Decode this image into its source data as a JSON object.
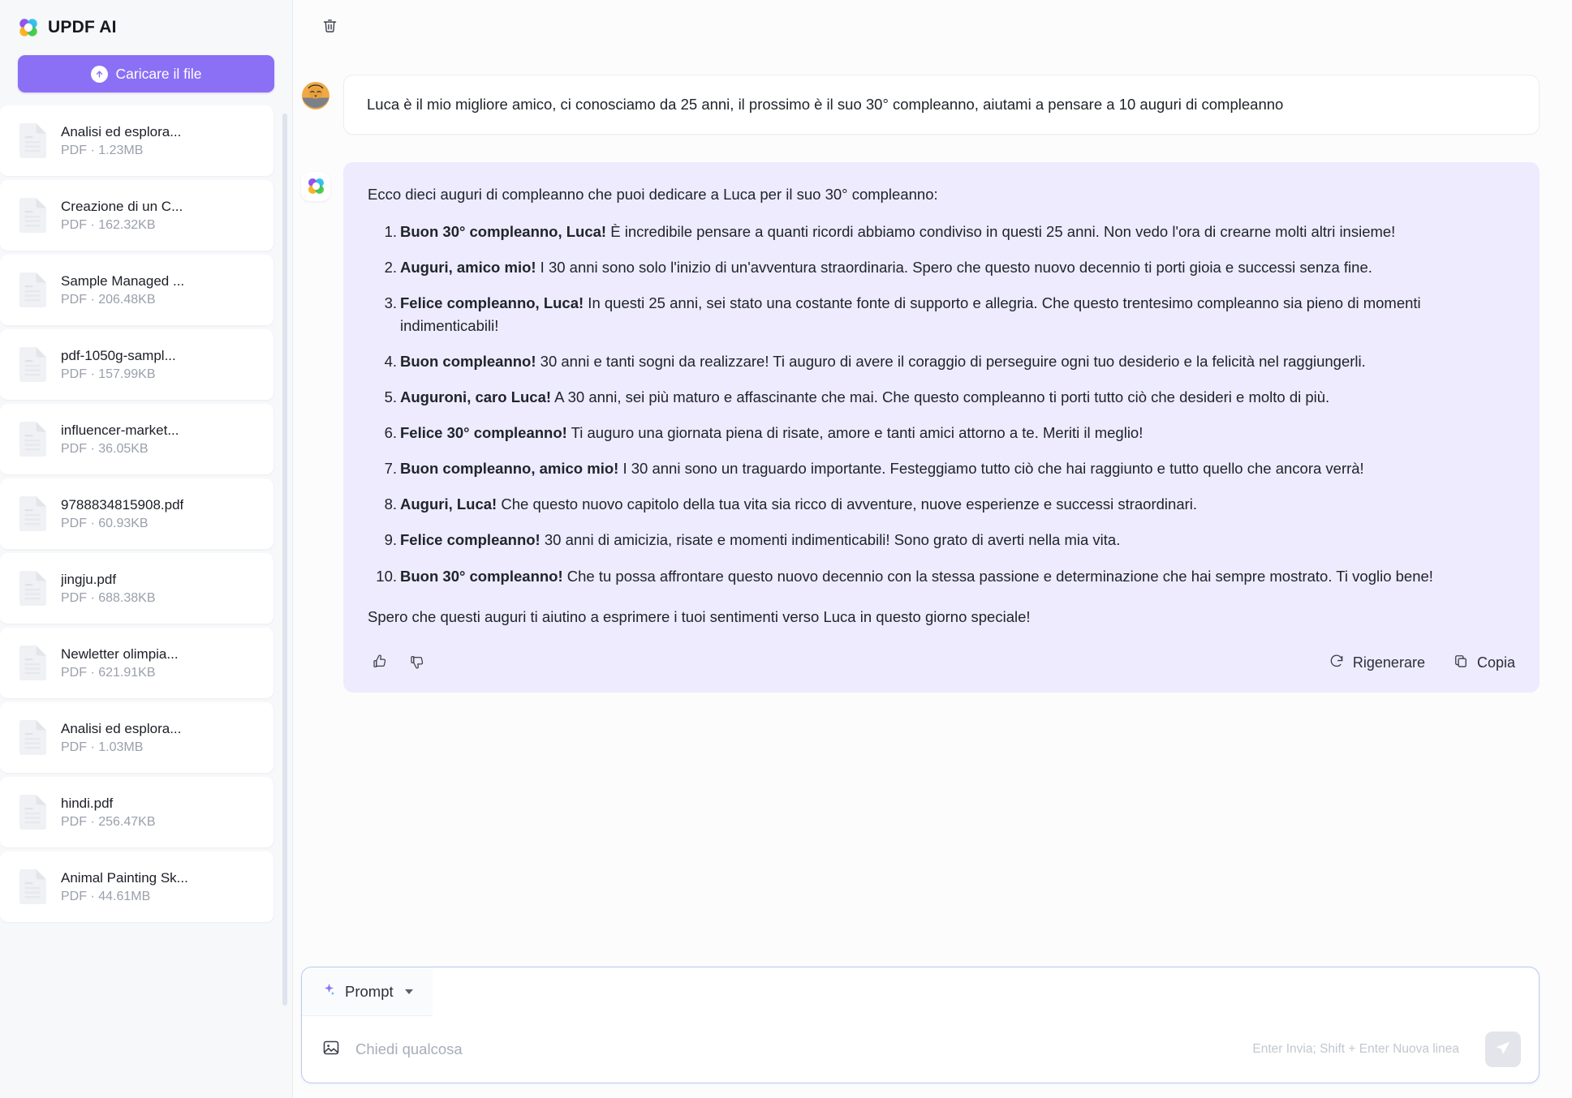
{
  "sidebar": {
    "brand": "UPDF AI",
    "brand_logo_icon": "updf-clover-logo-icon",
    "upload_button": {
      "label": "Caricare il file",
      "icon": "upload-arrow-icon",
      "color": "#8b6ff5"
    },
    "files": [
      {
        "name": "Analisi ed esplora...",
        "meta": "PDF · 1.23MB"
      },
      {
        "name": "Creazione di un C...",
        "meta": "PDF · 162.32KB"
      },
      {
        "name": "Sample Managed ...",
        "meta": "PDF · 206.48KB"
      },
      {
        "name": "pdf-1050g-sampl...",
        "meta": "PDF · 157.99KB"
      },
      {
        "name": "influencer-market...",
        "meta": "PDF · 36.05KB"
      },
      {
        "name": "9788834815908.pdf",
        "meta": "PDF · 60.93KB"
      },
      {
        "name": "jingju.pdf",
        "meta": "PDF · 688.38KB"
      },
      {
        "name": "Newletter olimpia...",
        "meta": "PDF · 621.91KB"
      },
      {
        "name": "Analisi ed esplora...",
        "meta": "PDF · 1.03MB"
      },
      {
        "name": "hindi.pdf",
        "meta": "PDF · 256.47KB"
      },
      {
        "name": "Animal Painting Sk...",
        "meta": "PDF · 44.61MB"
      }
    ]
  },
  "topbar": {
    "delete_icon": "trash-icon"
  },
  "conversation": {
    "user": {
      "avatar_icon": "user-avatar",
      "text": "Luca è il mio migliore amico, ci conosciamo da 25 anni, il prossimo è il suo 30° compleanno, aiutami a pensare a 10 auguri di compleanno"
    },
    "assistant": {
      "avatar_icon": "updf-clover-logo-icon",
      "bubble_color": "#edebfd",
      "intro": "Ecco dieci auguri di compleanno che puoi dedicare a Luca per il suo 30° compleanno:",
      "items": [
        {
          "bold": "Buon 30° compleanno, Luca!",
          "rest": " È incredibile pensare a quanti ricordi abbiamo condiviso in questi 25 anni. Non vedo l'ora di crearne molti altri insieme!"
        },
        {
          "bold": "Auguri, amico mio!",
          "rest": " I 30 anni sono solo l'inizio di un'avventura straordinaria. Spero che questo nuovo decennio ti porti gioia e successi senza fine."
        },
        {
          "bold": "Felice compleanno, Luca!",
          "rest": " In questi 25 anni, sei stato una costante fonte di supporto e allegria. Che questo trentesimo compleanno sia pieno di momenti indimenticabili!"
        },
        {
          "bold": "Buon compleanno!",
          "rest": " 30 anni e tanti sogni da realizzare! Ti auguro di avere il coraggio di perseguire ogni tuo desiderio e la felicità nel raggiungerli."
        },
        {
          "bold": "Auguroni, caro Luca!",
          "rest": " A 30 anni, sei più maturo e affascinante che mai. Che questo compleanno ti porti tutto ciò che desideri e molto di più."
        },
        {
          "bold": "Felice 30° compleanno!",
          "rest": " Ti auguro una giornata piena di risate, amore e tanti amici attorno a te. Meriti il meglio!"
        },
        {
          "bold": "Buon compleanno, amico mio!",
          "rest": " I 30 anni sono un traguardo importante. Festeggiamo tutto ciò che hai raggiunto e tutto quello che ancora verrà!"
        },
        {
          "bold": "Auguri, Luca!",
          "rest": " Che questo nuovo capitolo della tua vita sia ricco di avventure, nuove esperienze e successi straordinari."
        },
        {
          "bold": "Felice compleanno!",
          "rest": " 30 anni di amicizia, risate e momenti indimenticabili! Sono grato di averti nella mia vita."
        },
        {
          "bold": "Buon 30° compleanno!",
          "rest": " Che tu possa affrontare questo nuovo decennio con la stessa passione e determinazione che hai sempre mostrato. Ti voglio bene!"
        }
      ],
      "outro": "Spero che questi auguri ti aiutino a esprimere i tuoi sentimenti verso Luca in questo giorno speciale!",
      "actions": {
        "thumbs_up_icon": "thumbs-up-icon",
        "thumbs_down_icon": "thumbs-down-icon",
        "regenerate_label": "Rigenerare",
        "regenerate_icon": "refresh-icon",
        "copy_label": "Copia",
        "copy_icon": "copy-icon"
      }
    }
  },
  "composer": {
    "prompt_label": "Prompt",
    "prompt_icon": "sparkle-icon",
    "dropdown_icon": "chevron-down-icon",
    "image_icon": "image-icon",
    "placeholder": "Chiedi qualcosa",
    "hint": "Enter Invia; Shift + Enter Nuova linea",
    "send_icon": "send-plane-icon"
  }
}
